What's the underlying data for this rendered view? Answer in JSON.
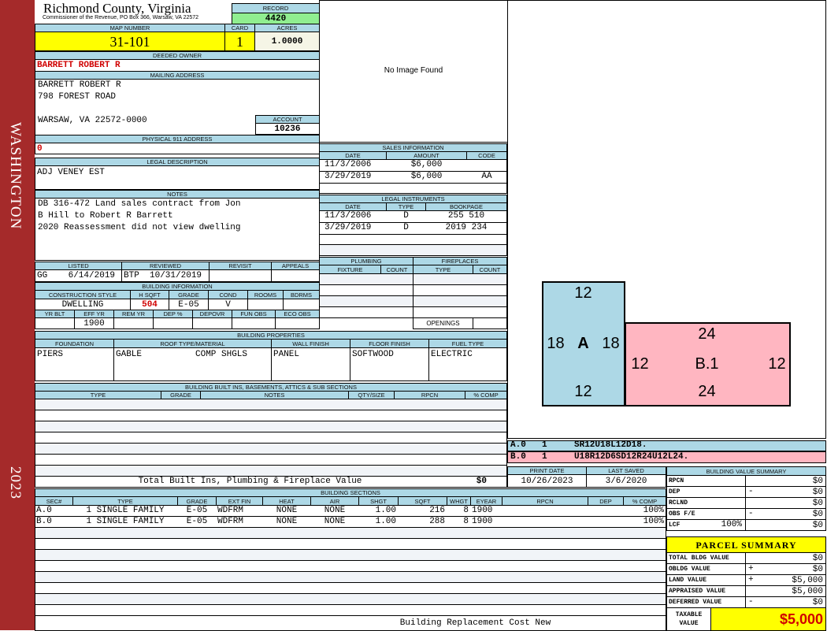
{
  "side": {
    "label": "WASHINGTON",
    "year": "2023",
    "color": "#a52a2a"
  },
  "header": {
    "title": "Richmond County, Virginia",
    "subtitle": "Commissioner of the Revenue, PO Box 366, Warsaw, VA 22572",
    "record_label": "RECORD",
    "record": "4420"
  },
  "parcel": {
    "map_label": "MAP NUMBER",
    "map": "31-101",
    "card_label": "CARD",
    "card": "1",
    "acres_label": "ACRES",
    "acres": "1.0000"
  },
  "owner": {
    "label": "DEEDED OWNER",
    "name": "BARRETT ROBERT R"
  },
  "mailing": {
    "label": "MAILING ADDRESS",
    "lines": [
      "BARRETT ROBERT R",
      "798 FOREST ROAD",
      "WARSAW, VA 22572-0000"
    ],
    "account_label": "ACCOUNT",
    "account": "10236"
  },
  "physical": {
    "label": "PHYSICAL 911 ADDRESS",
    "value": "0"
  },
  "legal": {
    "label": "LEGAL DESCRIPTION",
    "value": "ADJ VENEY EST"
  },
  "notes": {
    "label": "NOTES",
    "lines": [
      "DB 316-472 Land sales contract from Jon",
      "B Hill to Robert R Barrett",
      "2020 Reassessment did not view dwelling"
    ]
  },
  "review": {
    "headers": [
      "LISTED",
      "REVIEWED",
      "REVISIT",
      "APPEALS"
    ],
    "values": [
      "GG    6/14/2019",
      "BTP  10/31/2019",
      "",
      ""
    ]
  },
  "building_info": {
    "label": "BUILDING INFORMATION",
    "headers1": [
      "CONSTRUCTION STYLE",
      "H SQFT",
      "GRADE",
      "COND",
      "ROOMS",
      "BDRMS"
    ],
    "values1": [
      "DWELLING",
      "504",
      "E-05",
      "V",
      "",
      ""
    ],
    "headers2": [
      "YR BLT",
      "EFF YR",
      "REM YR",
      "DEP %",
      "DEPOVR",
      "FUN OBS",
      "ECO OBS"
    ],
    "values2": [
      "",
      "1900",
      "",
      "",
      "",
      "",
      ""
    ]
  },
  "image": {
    "text": "No Image Found"
  },
  "sales": {
    "label": "SALES INFORMATION",
    "headers": [
      "DATE",
      "AMOUNT",
      "CODE"
    ],
    "rows": [
      [
        "11/3/2006",
        "$6,000",
        ""
      ],
      [
        "3/29/2019",
        "$6,000",
        "AA"
      ]
    ]
  },
  "legal_instruments": {
    "label": "LEGAL INSTRUMENTS",
    "headers": [
      "DATE",
      "TYPE",
      "BOOKPAGE"
    ],
    "rows": [
      [
        "11/3/2006",
        "D",
        "255 510"
      ],
      [
        "3/29/2019",
        "D",
        "2019 234"
      ]
    ]
  },
  "plumbing": {
    "label": "PLUMBING",
    "headers": [
      "FIXTURE",
      "COUNT"
    ]
  },
  "fireplaces": {
    "label": "FIREPLACES",
    "headers": [
      "TYPE",
      "COUNT"
    ],
    "openings_label": "OPENINGS"
  },
  "properties": {
    "label": "BUILDING PROPERTIES",
    "headers": [
      "FOUNDATION",
      "ROOF TYPE/MATERIAL",
      "WALL FINISH",
      "FLOOR FINISH",
      "FUEL TYPE"
    ],
    "values": [
      "PIERS",
      "GABLE",
      "PANEL",
      "SOFTWOOD",
      "ELECTRIC"
    ],
    "roof_material": "COMP SHGLS"
  },
  "builtins": {
    "label": "BUILDING BUILT INS, BASEMENTS, ATTICS & SUB SECTIONS",
    "headers": [
      "TYPE",
      "GRADE",
      "NOTES",
      "QTY/SIZE",
      "RPCN",
      "% COMP"
    ],
    "total_label": "Total Built Ins, Plumbing & Fireplace Value",
    "total": "$0"
  },
  "sketch": {
    "a": {
      "id": "A",
      "top": "12",
      "left": "18",
      "right": "18",
      "bottom": "12",
      "color": "#add8e6"
    },
    "b": {
      "id": "B.1",
      "top": "24",
      "left": "12",
      "right": "12",
      "bottom": "24",
      "color": "#ffb6c1"
    },
    "legend": [
      [
        "A.0",
        "1",
        "SR12U18L12D18."
      ],
      [
        "B.0",
        "1",
        "U18R12D6SD12R24U12L24."
      ]
    ]
  },
  "dates": {
    "print_label": "PRINT DATE",
    "print": "10/26/2023",
    "saved_label": "LAST SAVED",
    "saved": "3/6/2020"
  },
  "sections": {
    "label": "BUILDING SECTIONS",
    "headers": [
      "SEC#",
      "TYPE",
      "GRADE",
      "EXT FIN",
      "HEAT",
      "AIR",
      "SHGT",
      "SQFT",
      "WHGT",
      "EYEAR",
      "RPCN",
      "DEP",
      "% COMP"
    ],
    "rows": [
      [
        "A.0",
        "1 SINGLE FAMILY",
        "E-05",
        "WDFRM",
        "NONE",
        "NONE",
        "1.00",
        "216",
        "8",
        "1900",
        "",
        "",
        "100%"
      ],
      [
        "B.0",
        "1 SINGLE FAMILY",
        "E-05",
        "WDFRM",
        "NONE",
        "NONE",
        "1.00",
        "288",
        "8",
        "1900",
        "",
        "",
        "100%"
      ]
    ],
    "footer": "Building Replacement Cost New"
  },
  "value_summary": {
    "label": "BUILDING VALUE SUMMARY",
    "rows": [
      [
        "RPCN",
        "",
        "",
        "$0"
      ],
      [
        "DEP",
        "",
        "-",
        "$0"
      ],
      [
        "RCLND",
        "",
        "",
        "$0"
      ],
      [
        "OBS F/E",
        "",
        "-",
        "$0"
      ],
      [
        "LCF",
        "100%",
        "",
        "$0"
      ]
    ]
  },
  "parcel_summary": {
    "label": "PARCEL SUMMARY",
    "rows": [
      [
        "TOTAL BLDG VALUE",
        "",
        "$0"
      ],
      [
        "OBLDG VALUE",
        "+",
        "$0"
      ],
      [
        "LAND VALUE",
        "+",
        "$5,000"
      ],
      [
        "APPRAISED VALUE",
        "",
        "$5,000"
      ],
      [
        "DEFERRED VALUE",
        "-",
        "$0"
      ]
    ],
    "taxable_label": "TAXABLE\nVALUE",
    "taxable": "$5,000"
  }
}
